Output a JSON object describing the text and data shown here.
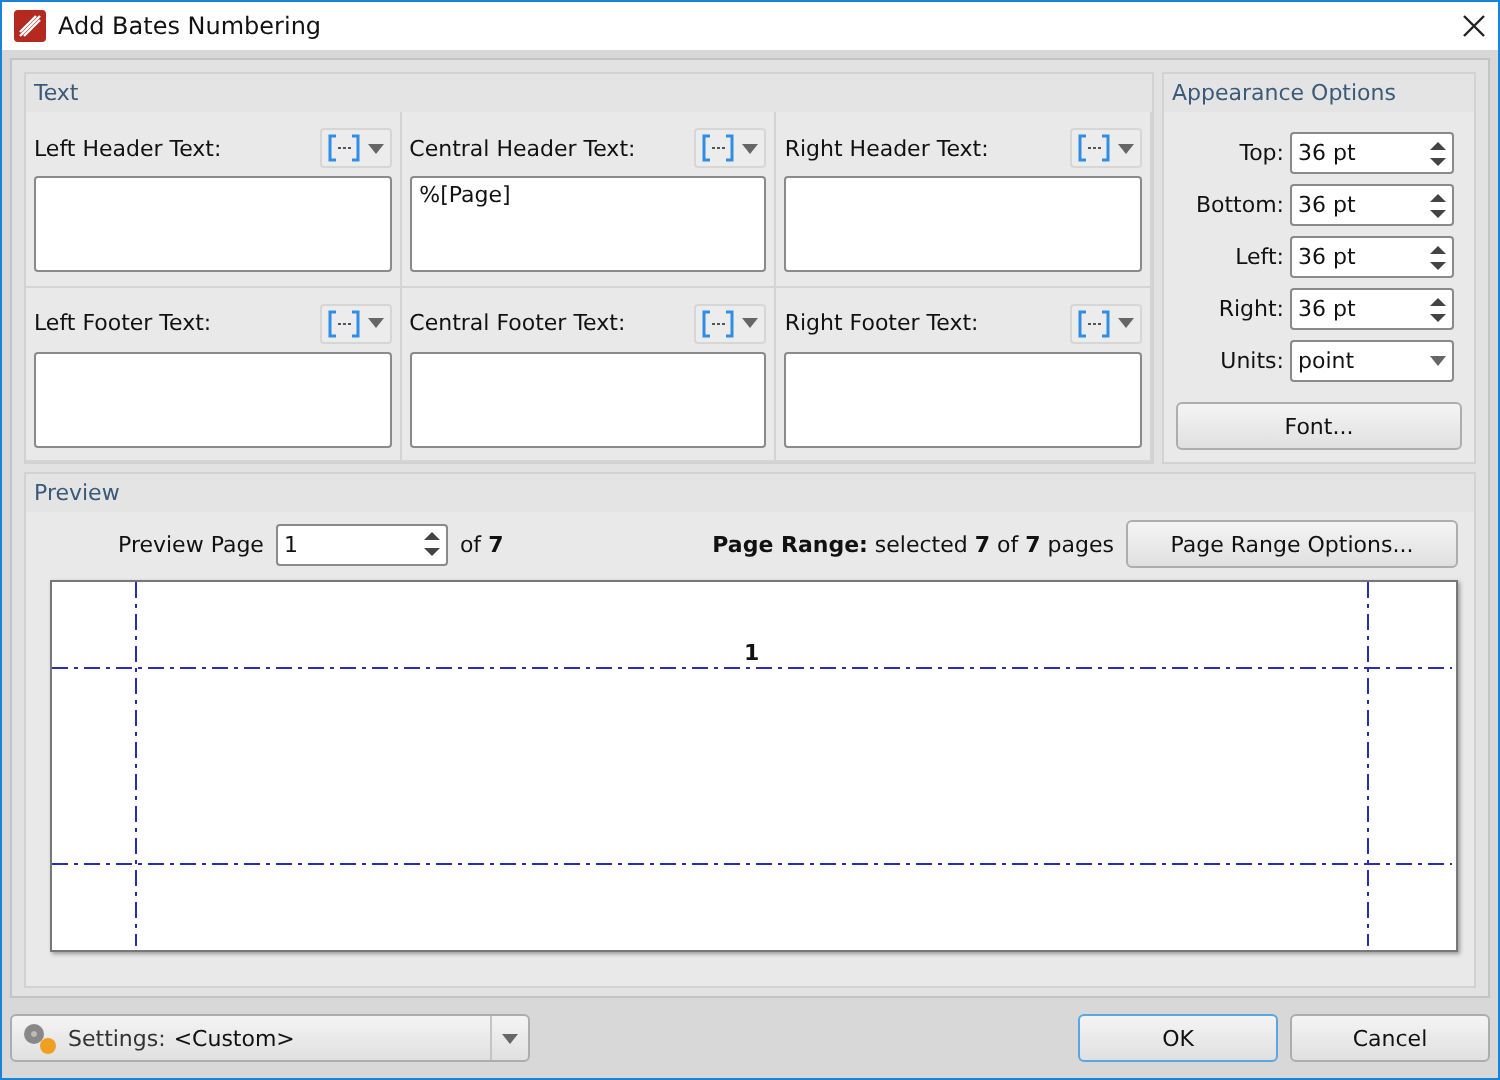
{
  "window": {
    "title": "Add Bates Numbering"
  },
  "text_group": {
    "title": "Text",
    "fields": [
      {
        "label": "Left Header Text:"
      },
      {
        "label": "Central Header Text:",
        "value": "%[Page]"
      },
      {
        "label": "Right Header Text:"
      },
      {
        "label": "Left Footer Text:"
      },
      {
        "label": "Central Footer Text:"
      },
      {
        "label": "Right Footer Text:"
      }
    ]
  },
  "appearance": {
    "title": "Appearance Options",
    "fields": [
      {
        "label": "Top:",
        "value": "36 pt",
        "kind": "spin"
      },
      {
        "label": "Bottom:",
        "value": "36 pt",
        "kind": "spin"
      },
      {
        "label": "Left:",
        "value": "36 pt",
        "kind": "spin"
      },
      {
        "label": "Right:",
        "value": "36 pt",
        "kind": "spin"
      },
      {
        "label": "Units:",
        "value": "point",
        "kind": "select"
      }
    ],
    "font_button": "Font..."
  },
  "preview": {
    "title": "Preview",
    "page_label": "Preview Page",
    "page_value": "1",
    "of_text": "of **7**",
    "range_text": "**Page Range:** selected **7** of **7** pages",
    "range_button": "Page Range Options...",
    "page_number": "1"
  },
  "footer": {
    "settings_label": "Settings:",
    "settings_value": "<Custom>",
    "buttons": [
      "OK",
      "Cancel"
    ]
  }
}
